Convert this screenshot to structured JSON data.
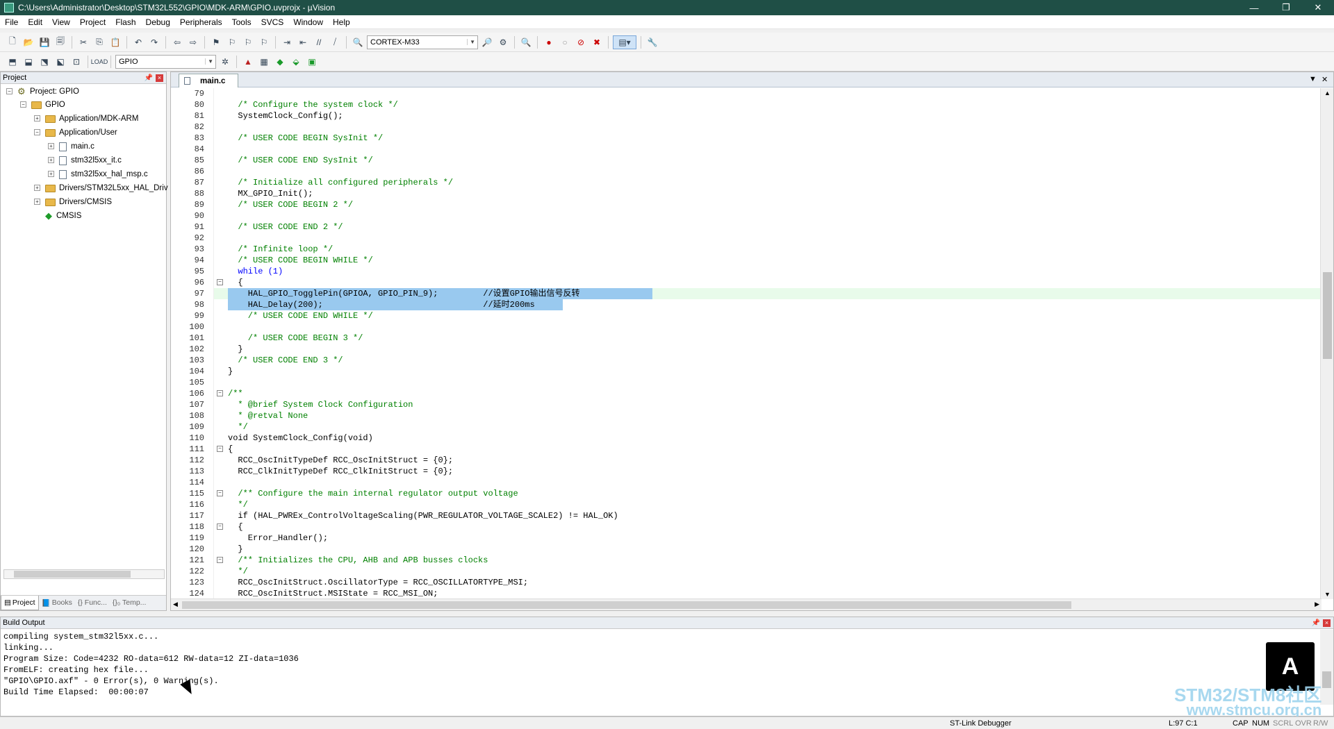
{
  "window": {
    "title": "C:\\Users\\Administrator\\Desktop\\STM32L552\\GPIO\\MDK-ARM\\GPIO.uvprojx - µVision",
    "minimize": "—",
    "restore": "❐",
    "close": "✕"
  },
  "menu": [
    "File",
    "Edit",
    "View",
    "Project",
    "Flash",
    "Debug",
    "Peripherals",
    "Tools",
    "SVCS",
    "Window",
    "Help"
  ],
  "toolbar": {
    "device": "CORTEX-M33",
    "target": "GPIO"
  },
  "project_panel": {
    "title": "Project",
    "tree": [
      {
        "label": "Project: GPIO",
        "type": "project"
      },
      {
        "label": "GPIO",
        "type": "folder"
      },
      {
        "label": "Application/MDK-ARM",
        "type": "folder"
      },
      {
        "label": "Application/User",
        "type": "folder"
      },
      {
        "label": "main.c",
        "type": "file"
      },
      {
        "label": "stm32l5xx_it.c",
        "type": "file"
      },
      {
        "label": "stm32l5xx_hal_msp.c",
        "type": "file"
      },
      {
        "label": "Drivers/STM32L5xx_HAL_Driv",
        "type": "folder"
      },
      {
        "label": "Drivers/CMSIS",
        "type": "folder"
      },
      {
        "label": "CMSIS",
        "type": "component"
      }
    ],
    "tabs": [
      "Project",
      "Books",
      "{} Func...",
      "{}₀ Temp..."
    ]
  },
  "editor": {
    "tab": "main.c",
    "lines": [
      {
        "n": "79",
        "t": ""
      },
      {
        "n": "80",
        "t": "  /* Configure the system clock */",
        "c": "cm"
      },
      {
        "n": "81",
        "t": "  SystemClock_Config();"
      },
      {
        "n": "82",
        "t": ""
      },
      {
        "n": "83",
        "t": "  /* USER CODE BEGIN SysInit */",
        "c": "cm"
      },
      {
        "n": "84",
        "t": ""
      },
      {
        "n": "85",
        "t": "  /* USER CODE END SysInit */",
        "c": "cm"
      },
      {
        "n": "86",
        "t": ""
      },
      {
        "n": "87",
        "t": "  /* Initialize all configured peripherals */",
        "c": "cm"
      },
      {
        "n": "88",
        "t": "  MX_GPIO_Init();"
      },
      {
        "n": "89",
        "t": "  /* USER CODE BEGIN 2 */",
        "c": "cm"
      },
      {
        "n": "90",
        "t": ""
      },
      {
        "n": "91",
        "t": "  /* USER CODE END 2 */",
        "c": "cm"
      },
      {
        "n": "92",
        "t": ""
      },
      {
        "n": "93",
        "t": "  /* Infinite loop */",
        "c": "cm"
      },
      {
        "n": "94",
        "t": "  /* USER CODE BEGIN WHILE */",
        "c": "cm"
      },
      {
        "n": "95",
        "t": "  while (1)",
        "c": "kw"
      },
      {
        "n": "96",
        "t": "  {",
        "fold": "⊟"
      },
      {
        "n": "97",
        "t": "    HAL_GPIO_TogglePin(GPIOA, GPIO_PIN_9);         //设置GPIO输出信号反转",
        "hl": "1"
      },
      {
        "n": "98",
        "t": "    HAL_Delay(200);                                //延时200ms",
        "hl": "2"
      },
      {
        "n": "99",
        "t": "    /* USER CODE END WHILE */",
        "c": "cm"
      },
      {
        "n": "100",
        "t": ""
      },
      {
        "n": "101",
        "t": "    /* USER CODE BEGIN 3 */",
        "c": "cm"
      },
      {
        "n": "102",
        "t": "  }"
      },
      {
        "n": "103",
        "t": "  /* USER CODE END 3 */",
        "c": "cm"
      },
      {
        "n": "104",
        "t": "}"
      },
      {
        "n": "105",
        "t": ""
      },
      {
        "n": "106",
        "t": "/**",
        "c": "cm",
        "fold": "⊟"
      },
      {
        "n": "107",
        "t": "  * @brief System Clock Configuration",
        "c": "cm"
      },
      {
        "n": "108",
        "t": "  * @retval None",
        "c": "cm"
      },
      {
        "n": "109",
        "t": "  */",
        "c": "cm"
      },
      {
        "n": "110",
        "t": "void SystemClock_Config(void)"
      },
      {
        "n": "111",
        "t": "{",
        "fold": "⊟"
      },
      {
        "n": "112",
        "t": "  RCC_OscInitTypeDef RCC_OscInitStruct = {0};"
      },
      {
        "n": "113",
        "t": "  RCC_ClkInitTypeDef RCC_ClkInitStruct = {0};"
      },
      {
        "n": "114",
        "t": ""
      },
      {
        "n": "115",
        "t": "  /** Configure the main internal regulator output voltage",
        "c": "cm",
        "fold": "⊟"
      },
      {
        "n": "116",
        "t": "  */",
        "c": "cm"
      },
      {
        "n": "117",
        "t": "  if (HAL_PWREx_ControlVoltageScaling(PWR_REGULATOR_VOLTAGE_SCALE2) != HAL_OK)"
      },
      {
        "n": "118",
        "t": "  {",
        "fold": "⊟"
      },
      {
        "n": "119",
        "t": "    Error_Handler();"
      },
      {
        "n": "120",
        "t": "  }"
      },
      {
        "n": "121",
        "t": "  /** Initializes the CPU, AHB and APB busses clocks",
        "c": "cm",
        "fold": "⊟"
      },
      {
        "n": "122",
        "t": "  */",
        "c": "cm"
      },
      {
        "n": "123",
        "t": "  RCC_OscInitStruct.OscillatorType = RCC_OSCILLATORTYPE_MSI;"
      },
      {
        "n": "124",
        "t": "  RCC_OscInitStruct.MSIState = RCC_MSI_ON;"
      }
    ]
  },
  "build_output": {
    "title": "Build Output",
    "lines": [
      "compiling system_stm32l5xx.c...",
      "linking...",
      "Program Size: Code=4232 RO-data=612 RW-data=12 ZI-data=1036",
      "FromELF: creating hex file...",
      "\"GPIO\\GPIO.axf\" - 0 Error(s), 0 Warning(s).",
      "Build Time Elapsed:  00:00:07"
    ]
  },
  "watermark": {
    "line1": "STM32/STM8社区",
    "line2": "www.stmcu.org.cn"
  },
  "status": {
    "debugger": "ST-Link Debugger",
    "position": "L:97 C:1",
    "cap": "CAP",
    "num": "NUM",
    "scrl": "SCRL",
    "ovr": "OVR",
    "rw": "R/W"
  }
}
